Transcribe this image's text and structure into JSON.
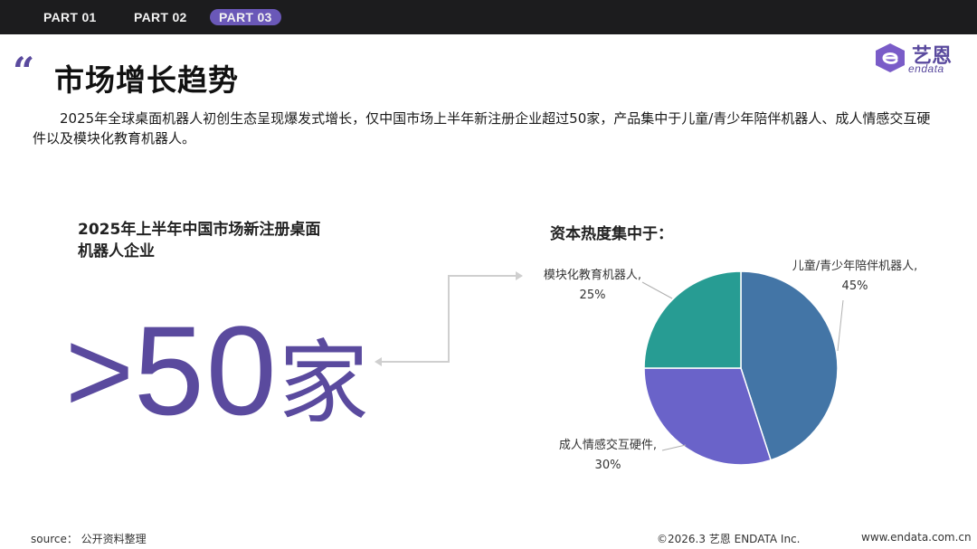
{
  "nav": {
    "tabs": [
      {
        "label": "PART 01",
        "active": false
      },
      {
        "label": "PART 02",
        "active": false
      },
      {
        "label": "PART 03",
        "active": true
      }
    ]
  },
  "header": {
    "title": "市场增长趋势",
    "logo_cn": "艺恩",
    "logo_en": "endata"
  },
  "intro": "2025年全球桌面机器人初创生态呈现爆发式增长，仅中国市场上半年新注册企业超过50家，产品集中于儿童/青少年陪伴机器人、成人情感交互硬件以及模块化教育机器人。",
  "stat": {
    "heading": "2025年上半年中国市场新注册桌面机器人企业",
    "prefix": ">",
    "value": "50",
    "unit": "家"
  },
  "chart_data": {
    "type": "pie",
    "title": "资本热度集中于：",
    "slices": [
      {
        "label": "儿童/青少年陪伴机器人",
        "value": 45,
        "display": "45%",
        "color": "#4375a6"
      },
      {
        "label": "成人情感交互硬件",
        "value": 30,
        "display": "30%",
        "color": "#6a63c9"
      },
      {
        "label": "模块化教育机器人",
        "value": 25,
        "display": "25%",
        "color": "#279c93"
      }
    ]
  },
  "footer": {
    "source": "source： 公开资料整理",
    "copyright": "©2026.3  艺恩 ENDATA Inc.",
    "website": "www.endata.com.cn"
  }
}
